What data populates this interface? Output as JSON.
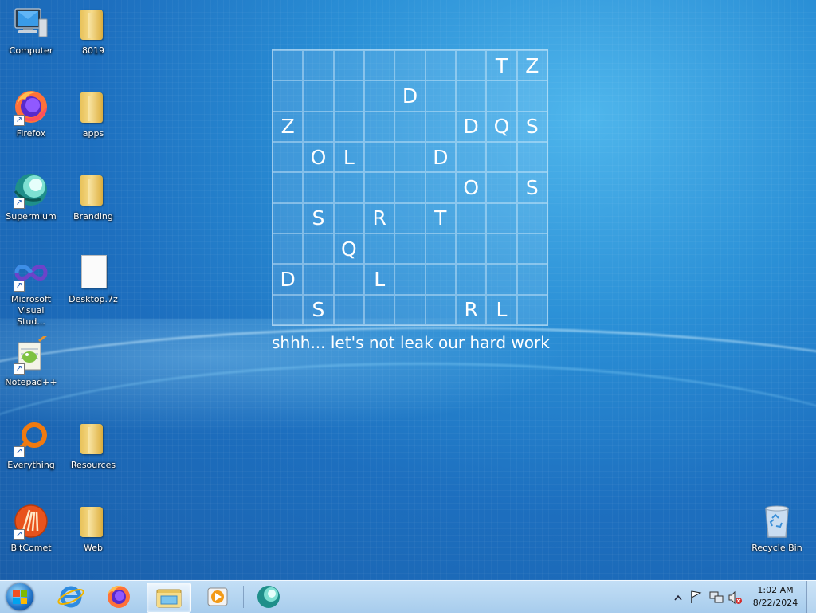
{
  "desktop_icons": [
    {
      "label": "Computer",
      "icon": "computer-icon",
      "shortcut": false
    },
    {
      "label": "8019",
      "icon": "folder-icon",
      "shortcut": false
    },
    {
      "label": "Firefox",
      "icon": "firefox-icon",
      "shortcut": true
    },
    {
      "label": "apps",
      "icon": "folder-icon",
      "shortcut": false
    },
    {
      "label": "Supermium",
      "icon": "supermium-icon",
      "shortcut": true
    },
    {
      "label": "Branding",
      "icon": "folder-icon",
      "shortcut": false
    },
    {
      "label": "Microsoft Visual Stud...",
      "icon": "visual-studio-icon",
      "shortcut": true
    },
    {
      "label": "Desktop.7z",
      "icon": "file-icon",
      "shortcut": false
    },
    {
      "label": "Notepad++",
      "icon": "notepad-plus-plus-icon",
      "shortcut": true
    },
    {
      "label": "Everything",
      "icon": "everything-icon",
      "shortcut": true
    },
    {
      "label": "Resources",
      "icon": "folder-icon",
      "shortcut": false
    },
    {
      "label": "BitComet",
      "icon": "bitcomet-icon",
      "shortcut": true
    },
    {
      "label": "Web",
      "icon": "folder-icon",
      "shortcut": false
    },
    {
      "label": "Recycle Bin",
      "icon": "recycle-bin-icon",
      "shortcut": false
    }
  ],
  "wallpaper": {
    "grid": [
      [
        "",
        "",
        "",
        "",
        "",
        "",
        "",
        "T",
        "Z"
      ],
      [
        "",
        "",
        "",
        "",
        "D",
        "",
        "",
        "",
        ""
      ],
      [
        "Z",
        "",
        "",
        "",
        "",
        "",
        "D",
        "Q",
        "S"
      ],
      [
        "",
        "O",
        "L",
        "",
        "",
        "D",
        "",
        "",
        ""
      ],
      [
        "",
        "",
        "",
        "",
        "",
        "",
        "O",
        "",
        "S"
      ],
      [
        "",
        "S",
        "",
        "R",
        "",
        "T",
        "",
        "",
        ""
      ],
      [
        "",
        "",
        "Q",
        "",
        "",
        "",
        "",
        "",
        ""
      ],
      [
        "D",
        "",
        "",
        "L",
        "",
        "",
        "",
        "",
        ""
      ],
      [
        "",
        "S",
        "",
        "",
        "",
        "",
        "R",
        "L",
        ""
      ]
    ],
    "caption": "shhh... let's not leak our hard work"
  },
  "taskbar": {
    "items": [
      {
        "name": "start-button",
        "icon": "windows-logo-icon"
      },
      {
        "name": "internet-explorer",
        "icon": "internet-explorer-icon"
      },
      {
        "name": "firefox",
        "icon": "firefox-icon"
      },
      {
        "name": "file-explorer",
        "icon": "file-explorer-icon",
        "active": true
      },
      {
        "name": "media-player",
        "icon": "media-player-icon"
      },
      {
        "name": "supermium",
        "icon": "supermium-icon"
      }
    ],
    "tray_icons": [
      "chevron-up-icon",
      "action-center-flag-icon",
      "network-icon",
      "volume-muted-icon"
    ],
    "time": "1:02 AM",
    "date": "8/22/2024"
  },
  "colors": {
    "wallpaper_blue": "#2a8fd6",
    "taskbar": "#b4d4ef"
  }
}
